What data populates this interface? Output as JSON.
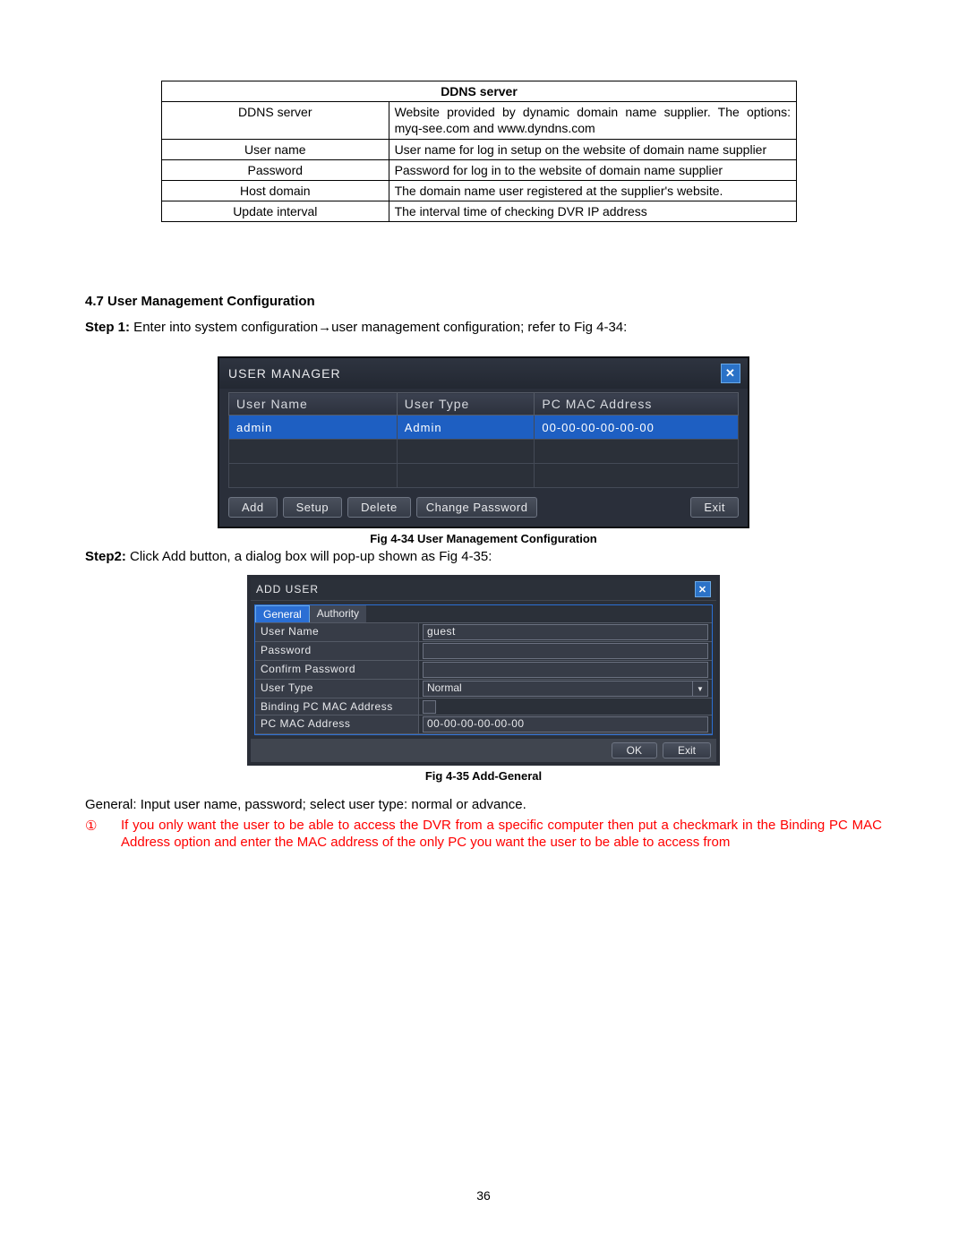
{
  "ddns": {
    "header": "DDNS server",
    "rows": [
      {
        "label": "DDNS server",
        "desc": "Website provided by dynamic domain name supplier. The options: myq-see.com and www.dyndns.com"
      },
      {
        "label": "User name",
        "desc": "User name for log in setup on the website of domain name supplier"
      },
      {
        "label": "Password",
        "desc": "Password for log in to the website of domain name supplier"
      },
      {
        "label": "Host domain",
        "desc": "The domain name user registered at the supplier's website."
      },
      {
        "label": "Update interval",
        "desc": "The interval time of checking DVR IP address"
      }
    ]
  },
  "section_heading": "4.7 User Management Configuration",
  "step1_label": "Step 1:",
  "step1_text": " Enter into system configuration→user management configuration; refer to Fig 4-34:",
  "user_manager": {
    "title": "USER MANAGER",
    "columns": [
      "User Name",
      "User Type",
      "PC MAC Address"
    ],
    "row": {
      "name": "admin",
      "type": "Admin",
      "mac": "00-00-00-00-00-00"
    },
    "buttons": {
      "add": "Add",
      "setup": "Setup",
      "delete": "Delete",
      "change_password": "Change Password",
      "exit": "Exit"
    }
  },
  "fig434_caption": "Fig 4-34 User Management Configuration",
  "step2_label": "Step2:",
  "step2_text": " Click Add button, a dialog box will pop-up shown as Fig 4-35:",
  "add_user": {
    "title": "ADD USER",
    "tabs": {
      "general": "General",
      "authority": "Authority"
    },
    "fields": {
      "user_name_label": "User Name",
      "user_name_value": "guest",
      "password_label": "Password",
      "confirm_password_label": "Confirm Password",
      "user_type_label": "User Type",
      "user_type_value": "Normal",
      "binding_mac_label": "Binding PC MAC Address",
      "mac_label": "PC MAC Address",
      "mac_value": "00-00-00-00-00-00"
    },
    "buttons": {
      "ok": "OK",
      "exit": "Exit"
    }
  },
  "fig435_caption": "Fig 4-35 Add-General",
  "general_line": "General: Input user name, password; select user type: normal or advance.",
  "note_number": "①",
  "note_text": "If you only want the user to be able to access the DVR from a specific computer then put a checkmark in the Binding PC MAC Address option and enter the MAC address of the only PC you want the user to be able to access from",
  "page_number": "36"
}
